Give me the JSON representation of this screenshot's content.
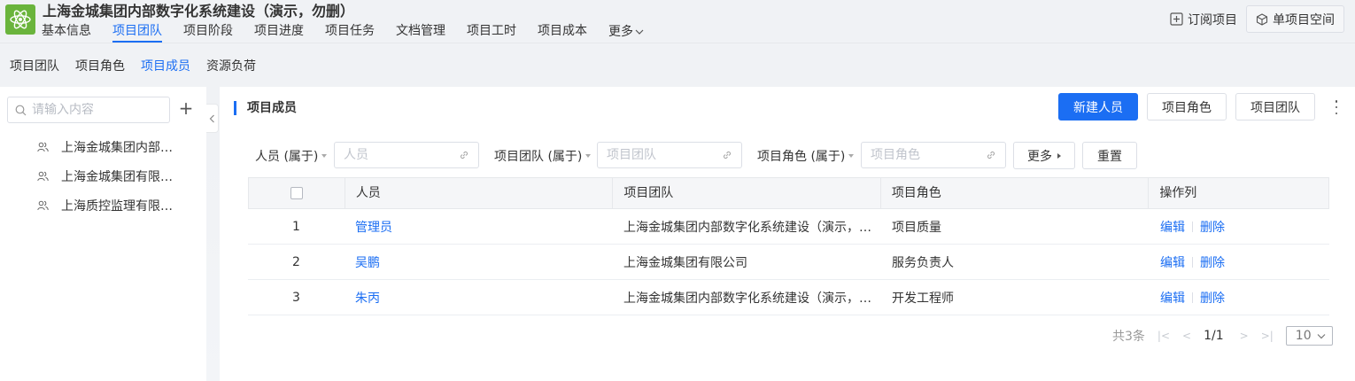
{
  "app": {
    "title": "上海金城集团内部数字化系统建设（演示，勿删）"
  },
  "main_nav": [
    {
      "label": "基本信息",
      "active": false
    },
    {
      "label": "项目团队",
      "active": true
    },
    {
      "label": "项目阶段",
      "active": false
    },
    {
      "label": "项目进度",
      "active": false
    },
    {
      "label": "项目任务",
      "active": false
    },
    {
      "label": "文档管理",
      "active": false
    },
    {
      "label": "项目工时",
      "active": false
    },
    {
      "label": "项目成本",
      "active": false
    },
    {
      "label": "更多",
      "active": false
    }
  ],
  "top_right": {
    "subscribe_label": "订阅项目",
    "space_label": "单项目空间"
  },
  "sub_tabs": [
    {
      "label": "项目团队",
      "active": false
    },
    {
      "label": "项目角色",
      "active": false
    },
    {
      "label": "项目成员",
      "active": true
    },
    {
      "label": "资源负荷",
      "active": false
    }
  ],
  "sidebar": {
    "search_placeholder": "请输入内容",
    "add_label": "+",
    "items": [
      {
        "label": "上海金城集团内部数字化系统建设（演示，勿删）"
      },
      {
        "label": "上海金城集团有限公司"
      },
      {
        "label": "上海质控监理有限公司"
      }
    ]
  },
  "main": {
    "section_title": "项目成员",
    "buttons": {
      "new_person": "新建人员",
      "project_role": "项目角色",
      "project_team": "项目团队"
    },
    "filters": {
      "person_label": "人员 (属于)",
      "person_placeholder": "人员",
      "team_label": "项目团队 (属于)",
      "team_placeholder": "项目团队",
      "role_label": "项目角色 (属于)",
      "role_placeholder": "项目角色",
      "more_label": "更多",
      "reset_label": "重置"
    },
    "table": {
      "columns": [
        "人员",
        "项目团队",
        "项目角色",
        "操作列"
      ],
      "rows": [
        {
          "index": "1",
          "person": "管理员",
          "team": "上海金城集团内部数字化系统建设（演示，勿删）",
          "role": "项目质量",
          "edit": "编辑",
          "delete": "删除"
        },
        {
          "index": "2",
          "person": "吴鹏",
          "team": "上海金城集团有限公司",
          "role": "服务负责人",
          "edit": "编辑",
          "delete": "删除"
        },
        {
          "index": "3",
          "person": "朱丙",
          "team": "上海金城集团内部数字化系统建设（演示，勿删）",
          "role": "开发工程师",
          "edit": "编辑",
          "delete": "删除"
        }
      ]
    },
    "pagination": {
      "total": "共3条",
      "page": "1/1",
      "page_size": "10"
    }
  },
  "colors": {
    "accent": "#1b6ef3",
    "logo_bg": "#6ab43c"
  }
}
